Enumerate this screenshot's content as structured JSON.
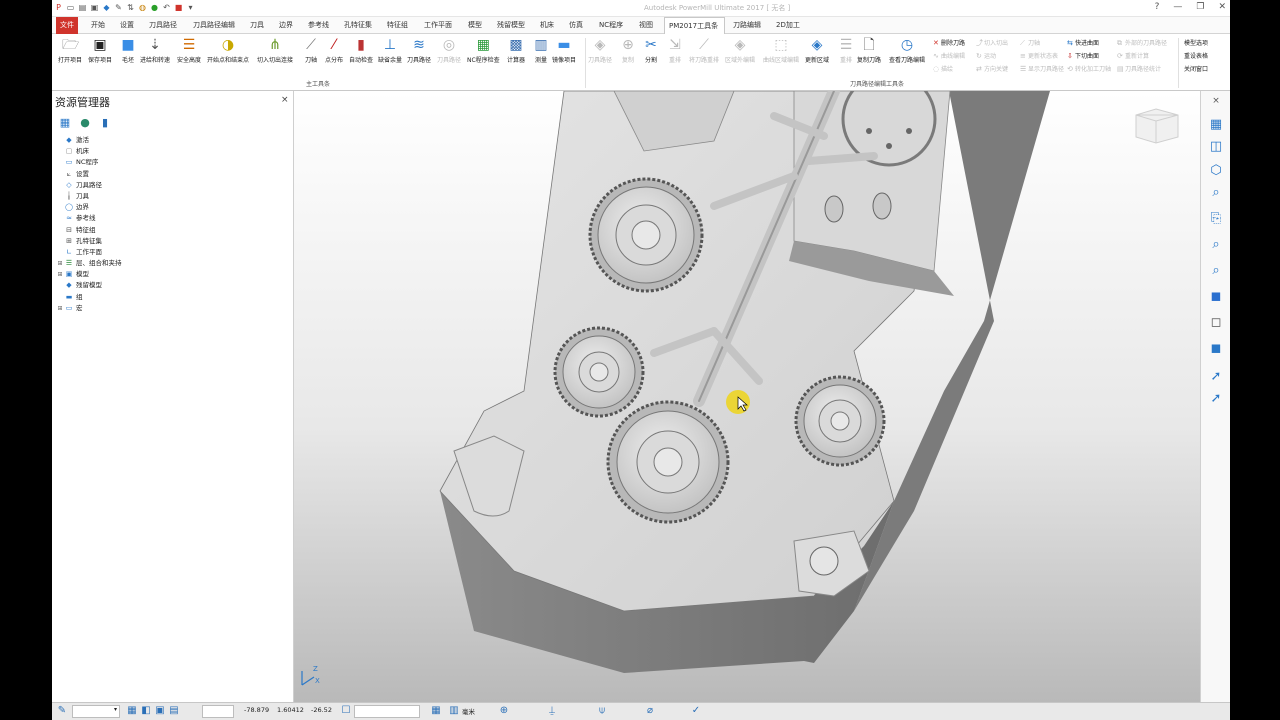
{
  "title": {
    "text": "Autodesk PowerMill Ultimate 2017    [ 无名 ]",
    "help": "?",
    "minimize": "—",
    "restore": "❐",
    "close": "✕"
  },
  "tabs": [
    "文件",
    "开始",
    "设置",
    "刀具路径",
    "刀具路径编辑",
    "刀具",
    "边界",
    "参考线",
    "孔特征集",
    "特征组",
    "工作平面",
    "模型",
    "残留模型",
    "机床",
    "仿真",
    "NC程序",
    "视图",
    "PM2017工具条",
    "刀路编辑",
    "2D加工"
  ],
  "active_tab": "PM2017工具条",
  "ribbon": {
    "main_group_label": "主工具条",
    "edit_group_label": "刀具路径编辑工具条",
    "main_buttons": [
      {
        "label": "打开项目",
        "icon": "folder-open-icon"
      },
      {
        "label": "保存项目",
        "icon": "save-icon"
      },
      {
        "label": "毛坯",
        "icon": "block-icon"
      },
      {
        "label": "进给和转速",
        "icon": "feed-speed-icon"
      },
      {
        "label": "安全高度",
        "icon": "rapid-height-icon"
      },
      {
        "label": "开始点和结束点",
        "icon": "start-end-point-icon"
      },
      {
        "label": "切入切出连接",
        "icon": "leads-links-icon"
      },
      {
        "label": "刀轴",
        "icon": "tool-axis-icon"
      },
      {
        "label": "点分布",
        "icon": "point-distribution-icon"
      },
      {
        "label": "自动检查",
        "icon": "auto-verify-icon"
      },
      {
        "label": "缺省余量",
        "icon": "thickness-icon"
      },
      {
        "label": "刀具路径",
        "icon": "toolpath-icon"
      },
      {
        "label": "刀具路径",
        "icon": "toolpath-disabled-icon"
      },
      {
        "label": "NC程序检查",
        "icon": "nc-check-icon"
      },
      {
        "label": "计算器",
        "icon": "calculator-icon"
      },
      {
        "label": "测量",
        "icon": "measure-icon"
      },
      {
        "label": "镜像项目",
        "icon": "mirror-project-icon"
      }
    ],
    "edit_buttons": [
      {
        "label": "刀具路径",
        "icon": "toolpath-edit-icon"
      },
      {
        "label": "复制",
        "icon": "copy-icon"
      },
      {
        "label": "分割",
        "icon": "split-icon"
      },
      {
        "label": "重排",
        "icon": "reorder-icon"
      },
      {
        "label": "将刀路重排",
        "icon": "reorder-toolpath-icon"
      },
      {
        "label": "区域外编辑",
        "icon": "outside-region-icon"
      },
      {
        "label": "曲线区域编辑",
        "icon": "curve-region-icon"
      },
      {
        "label": "更新区域",
        "icon": "update-region-icon"
      },
      {
        "label": "重排",
        "icon": "reorder2-icon"
      },
      {
        "label": "复制刀路",
        "icon": "copy-toolpath-icon"
      },
      {
        "label": "查看刀路编辑",
        "icon": "view-edit-icon"
      }
    ],
    "small_cmds_col1": [
      "删除刀路",
      "曲线编辑",
      "描绘"
    ],
    "small_cmds_col2": [
      "切入切出",
      "运动",
      "方向关键"
    ],
    "small_cmds_col3": [
      "刀轴",
      "更新状态表",
      "显示刀具路径"
    ],
    "small_cmds_col4": [
      "快进曲面",
      "下切曲面",
      "转化加工刀轴"
    ],
    "small_cmds_col5": [
      "外部的刀具路径",
      "重新计算",
      "刀具路径统计"
    ],
    "right_cmds": [
      "模型选项",
      "重设表格",
      "关闭窗口"
    ]
  },
  "explorer": {
    "title": "资源管理器",
    "close": "×",
    "tree": [
      {
        "label": "激活",
        "icon": "activate-icon",
        "expander": ""
      },
      {
        "label": "机床",
        "icon": "machine-icon",
        "expander": ""
      },
      {
        "label": "NC程序",
        "icon": "nc-program-icon",
        "expander": ""
      },
      {
        "label": "设置",
        "icon": "setup-icon",
        "expander": ""
      },
      {
        "label": "刀具路径",
        "icon": "toolpaths-icon",
        "expander": ""
      },
      {
        "label": "刀具",
        "icon": "tools-icon",
        "expander": ""
      },
      {
        "label": "边界",
        "icon": "boundaries-icon",
        "expander": ""
      },
      {
        "label": "参考线",
        "icon": "patterns-icon",
        "expander": ""
      },
      {
        "label": "特征组",
        "icon": "feature-groups-icon",
        "expander": ""
      },
      {
        "label": "孔特征集",
        "icon": "hole-feature-icon",
        "expander": ""
      },
      {
        "label": "工作平面",
        "icon": "workplanes-icon",
        "expander": ""
      },
      {
        "label": "层、组合和夹持",
        "icon": "levels-icon",
        "expander": "⊞"
      },
      {
        "label": "模型",
        "icon": "models-icon",
        "expander": "⊞"
      },
      {
        "label": "残留模型",
        "icon": "stock-models-icon",
        "expander": ""
      },
      {
        "label": "组",
        "icon": "groups-icon",
        "expander": ""
      },
      {
        "label": "宏",
        "icon": "macros-icon",
        "expander": "⊞"
      }
    ]
  },
  "statusbar": {
    "coord_x": "-78.879",
    "coord_y": "1.60412",
    "coord_z": "-26.52",
    "unit": "毫米"
  },
  "axis_indicator": {
    "label_z": "Z",
    "label_x": "X"
  }
}
